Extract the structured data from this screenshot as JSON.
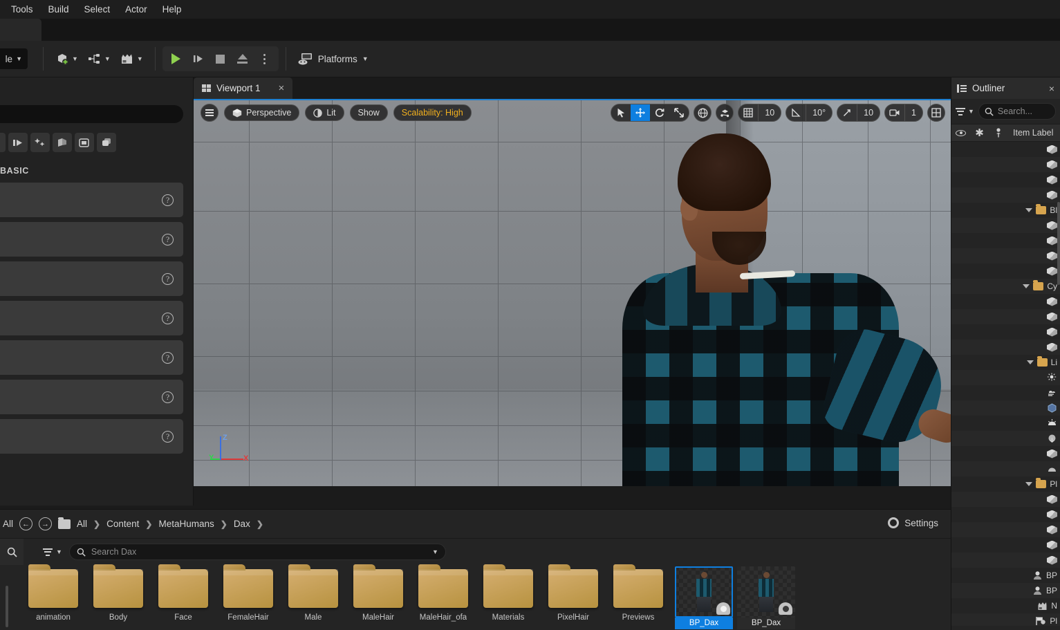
{
  "menubar": {
    "items": [
      {
        "label": "Tools",
        "name": "menu-tools"
      },
      {
        "label": "Build",
        "name": "menu-build"
      },
      {
        "label": "Select",
        "name": "menu-select"
      },
      {
        "label": "Actor",
        "name": "menu-actor"
      },
      {
        "label": "Help",
        "name": "menu-help"
      }
    ]
  },
  "toolbar": {
    "mode_dropdown_label": "le",
    "add_label": "",
    "blueprint_label": "",
    "cinematics_label": "",
    "platforms_label": "Platforms",
    "icons": {
      "add": "add-actor-icon",
      "blueprint": "blueprint-icon",
      "cinematics": "cinematics-icon",
      "play": "play-icon",
      "skip": "skip-frame-icon",
      "stop": "stop-icon",
      "eject": "eject-icon",
      "more": "more-options-icon",
      "platforms": "platforms-icon"
    }
  },
  "place_actors": {
    "search_placeholder": "",
    "category_label": "BASIC",
    "tool_icons": [
      "recently-placed-icon",
      "basic-icon",
      "lights-icon",
      "shapes-icon",
      "cinematic-icon",
      "visual-effects-icon"
    ],
    "rows": [
      {
        "help": "?"
      },
      {
        "help": "?"
      },
      {
        "help": "?"
      },
      {
        "help": "?"
      },
      {
        "help": "?"
      },
      {
        "help": "?"
      },
      {
        "help": "?"
      }
    ]
  },
  "viewport": {
    "tab_label": "Viewport 1",
    "tab_close": "×",
    "toolbar_left": [
      {
        "label": "Perspective",
        "name": "viewport-perspective-button",
        "icon": "cube-icon"
      },
      {
        "label": "Lit",
        "name": "viewport-lit-button",
        "icon": "lighting-icon"
      },
      {
        "label": "Show",
        "name": "viewport-show-button",
        "icon": ""
      },
      {
        "label": "Scalability: High",
        "name": "viewport-scalability-button",
        "icon": ""
      }
    ],
    "scalability_color": "#f2b01e",
    "transform_tools": [
      {
        "name": "select-tool",
        "icon": "cursor-icon",
        "active": false
      },
      {
        "name": "move-tool",
        "icon": "move-icon",
        "active": true
      },
      {
        "name": "rotate-tool",
        "icon": "rotate-icon",
        "active": false
      },
      {
        "name": "scale-tool",
        "icon": "scale-icon",
        "active": false
      }
    ],
    "coordinate_system": "world-icon",
    "surface_snap": "surface-snap-icon",
    "grid_snap_value": "10",
    "angle_snap_value": "10°",
    "scale_snap_value": "10",
    "camera_speed_value": "1",
    "layout_icon": "viewport-layout-icon",
    "active_tool_color": "#0e7fe0",
    "axis_labels": {
      "x": "X",
      "y": "Y",
      "z": "Z"
    },
    "axis_colors": {
      "x": "#e03b3b",
      "y": "#2fd44a",
      "z": "#3b6fe0"
    }
  },
  "content_browser": {
    "root_label": "All",
    "back_icon": "back-arrow-icon",
    "forward_icon": "forward-arrow-icon",
    "breadcrumb": [
      "All",
      "Content",
      "MetaHumans",
      "Dax"
    ],
    "breadcrumb_sep": "❯",
    "settings_label": "Settings",
    "search_placeholder": "Search Dax",
    "folders": [
      "animation",
      "Body",
      "Face",
      "FemaleHair",
      "Male",
      "MaleHair",
      "MaleHair_ofa",
      "Materials",
      "PixelHair",
      "Previews"
    ],
    "assets": [
      {
        "name": "BP_Dax",
        "selected": true
      },
      {
        "name": "BP_Dax",
        "selected": false
      }
    ]
  },
  "outliner": {
    "title": "Outliner",
    "close": "×",
    "search_placeholder": "Search...",
    "columns": [
      "",
      "",
      "",
      "Item Label"
    ],
    "column_icons": [
      "visibility-icon",
      "modified-icon",
      "pin-icon"
    ],
    "rows": [
      {
        "type": "actor",
        "icon": "cube-icon",
        "label": ""
      },
      {
        "type": "actor",
        "icon": "cube-icon",
        "label": ""
      },
      {
        "type": "actor",
        "icon": "cube-icon",
        "label": ""
      },
      {
        "type": "actor",
        "icon": "cube-icon",
        "label": ""
      },
      {
        "type": "folder",
        "icon": "folder-icon",
        "label": "Bl"
      },
      {
        "type": "actor",
        "icon": "cube-icon",
        "label": ""
      },
      {
        "type": "actor",
        "icon": "cube-icon",
        "label": ""
      },
      {
        "type": "actor",
        "icon": "cube-icon",
        "label": ""
      },
      {
        "type": "actor",
        "icon": "cube-icon",
        "label": ""
      },
      {
        "type": "folder",
        "icon": "folder-icon",
        "label": "Cy"
      },
      {
        "type": "actor",
        "icon": "cube-icon",
        "label": ""
      },
      {
        "type": "actor",
        "icon": "cube-icon",
        "label": ""
      },
      {
        "type": "actor",
        "icon": "cube-icon",
        "label": ""
      },
      {
        "type": "actor",
        "icon": "cube-icon",
        "label": ""
      },
      {
        "type": "folder",
        "icon": "folder-icon",
        "label": "Li"
      },
      {
        "type": "actor",
        "icon": "directional-light-icon",
        "label": ""
      },
      {
        "type": "actor",
        "icon": "sky-atmosphere-icon",
        "label": ""
      },
      {
        "type": "actor",
        "icon": "volume-icon",
        "label": ""
      },
      {
        "type": "actor",
        "icon": "sky-light-icon",
        "label": ""
      },
      {
        "type": "actor",
        "icon": "reflection-capture-icon",
        "label": ""
      },
      {
        "type": "actor",
        "icon": "cube-icon",
        "label": ""
      },
      {
        "type": "actor",
        "icon": "fog-icon",
        "label": ""
      },
      {
        "type": "folder",
        "icon": "folder-icon",
        "label": "Pl"
      },
      {
        "type": "actor",
        "icon": "cube-icon",
        "label": ""
      },
      {
        "type": "actor",
        "icon": "cube-icon",
        "label": ""
      },
      {
        "type": "actor",
        "icon": "cube-icon",
        "label": ""
      },
      {
        "type": "actor",
        "icon": "cube-icon",
        "label": ""
      },
      {
        "type": "actor",
        "icon": "cube-icon",
        "label": ""
      },
      {
        "type": "actor",
        "icon": "character-icon",
        "label": "BP"
      },
      {
        "type": "actor",
        "icon": "character-icon",
        "label": "BP"
      },
      {
        "type": "actor",
        "icon": "sequence-icon",
        "label": "N"
      },
      {
        "type": "actor",
        "icon": "player-start-icon",
        "label": "Pl"
      }
    ]
  }
}
